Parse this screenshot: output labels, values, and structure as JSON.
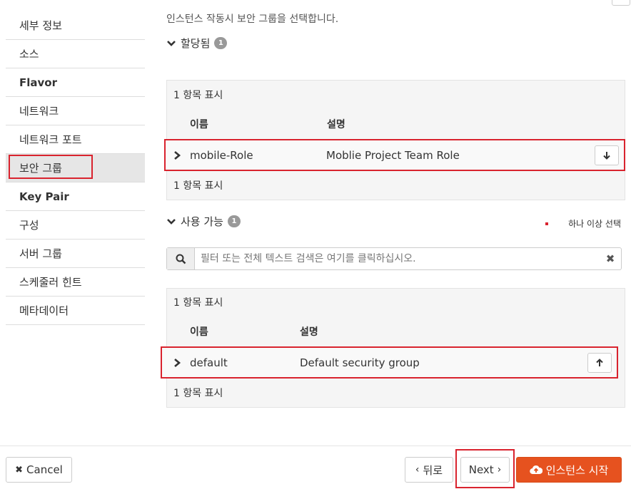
{
  "sidebar": {
    "items": [
      {
        "label": "세부 정보"
      },
      {
        "label": "소스"
      },
      {
        "label": "Flavor"
      },
      {
        "label": "네트워크"
      },
      {
        "label": "네트워크 포트"
      },
      {
        "label": "보안 그룹"
      },
      {
        "label": "Key Pair"
      },
      {
        "label": "구성"
      },
      {
        "label": "서버 그룹"
      },
      {
        "label": "스케줄러 힌트"
      },
      {
        "label": "메타데이터"
      }
    ]
  },
  "main": {
    "intro": "인스턴스 작동시 보안 그룹을 선택합니다.",
    "allocated": {
      "title": "할당됨",
      "count": "1",
      "display_top": "1 항목 표시",
      "display_bottom": "1 항목 표시",
      "col_name": "이름",
      "col_desc": "설명",
      "rows": [
        {
          "name": "mobile-Role",
          "desc": "Moblie Project Team Role"
        }
      ]
    },
    "available": {
      "title": "사용 가능",
      "count": "1",
      "select_note": "하나 이상 선택",
      "search_placeholder": "필터 또는 전체 텍스트 검색은 여기를 클릭하십시오.",
      "display_top": "1 항목 표시",
      "display_bottom": "1 항목 표시",
      "col_name": "이름",
      "col_desc": "설명",
      "rows": [
        {
          "name": "default",
          "desc": "Default security group"
        }
      ]
    }
  },
  "footer": {
    "cancel_label": "Cancel",
    "back_label": "뒤로",
    "next_label": "Next",
    "launch_label": "인스턴스 시작"
  },
  "colors": {
    "highlight": "#d9232e",
    "primary": "#e6521f"
  }
}
